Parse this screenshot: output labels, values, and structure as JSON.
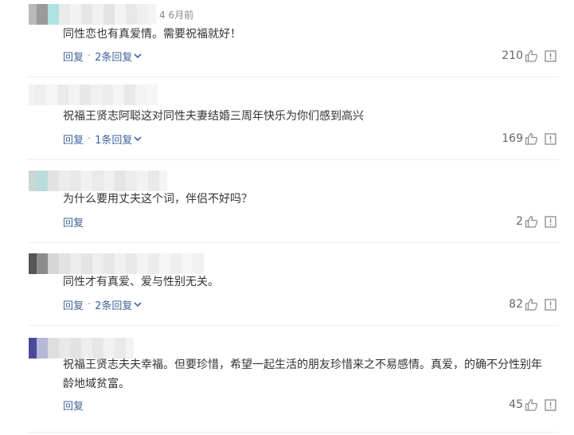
{
  "comments": [
    {
      "timestamp": "4 6月前",
      "text": "同性恋也有真爱情。需要祝福就好！",
      "reply_label": "回复",
      "reply_count_label": "2条回复",
      "likes": "210"
    },
    {
      "timestamp": "",
      "text": "祝福王贤志阿聪这对同性夫妻结婚三周年快乐为你们感到高兴",
      "reply_label": "回复",
      "reply_count_label": "1条回复",
      "likes": "169"
    },
    {
      "timestamp": "",
      "text": "为什么要用丈夫这个词，伴侣不好吗？",
      "reply_label": "回复",
      "reply_count_label": "",
      "likes": "2"
    },
    {
      "timestamp": "",
      "text": "同性才有真爱、爱与性别无关。",
      "reply_label": "回复",
      "reply_count_label": "2条回复",
      "likes": "82"
    },
    {
      "timestamp": "",
      "text": "祝福王贤志夫夫幸福。但要珍惜，希望一起生活的朋友珍惜来之不易感情。真爱，的确不分性别年龄地域贫富。",
      "reply_label": "回复",
      "reply_count_label": "",
      "likes": "45"
    }
  ],
  "icons": {
    "like": "thumbs-up-icon",
    "report": "report-icon",
    "expand": "chevron-down-icon"
  },
  "colors": {
    "link": "#406599",
    "text": "#333333",
    "muted": "#888888",
    "divider": "#ececec"
  }
}
